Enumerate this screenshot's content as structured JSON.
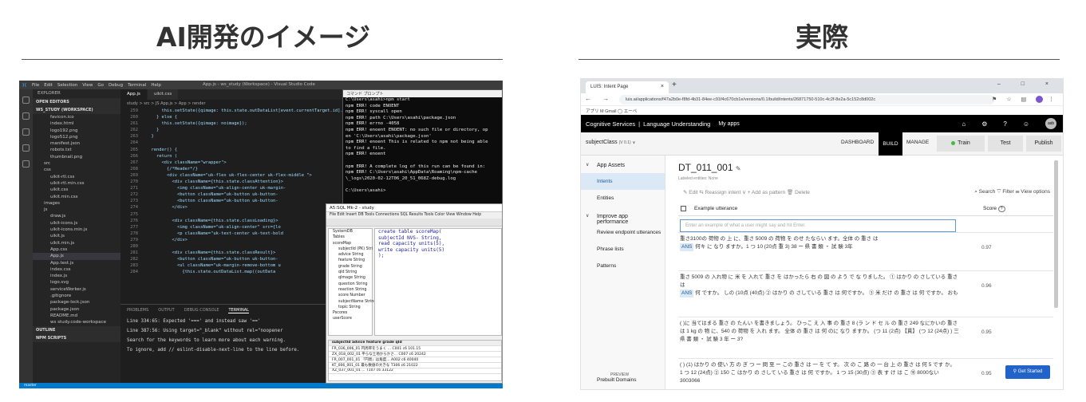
{
  "left": {
    "heading": "AI開発のイメージ",
    "vscode": {
      "menu": [
        "File",
        "Edit",
        "Selection",
        "View",
        "Go",
        "Debug",
        "Terminal",
        "Help"
      ],
      "window_title": "App.js - ws_study (Workspace) - Visual Studio Code",
      "explorer_title": "EXPLORER",
      "sections": [
        "OPEN EDITORS",
        "WS_STUDY (WORKSPACE)"
      ],
      "files": [
        "favicon.ico",
        "index.html",
        "logo192.png",
        "logo512.png",
        "manifest.json",
        "robots.txt",
        "thumbnail.png",
        "src",
        "css",
        "uikit-rtl.css",
        "uikit-rtl.min.css",
        "uikit.css",
        "uikit.min.css",
        "images",
        "js",
        "draw.js",
        "uikit-icons.js",
        "uikit-icons.min.js",
        "uikit.js",
        "uikit.min.js",
        "App.css",
        "App.js",
        "App.test.js",
        "index.css",
        "index.js",
        "logo.svg",
        "serviceWorker.js",
        ".gitignore",
        "package-lock.json",
        "package.json",
        "README.md",
        "ws study.code-workspace"
      ],
      "footer_sections": [
        "OUTLINE",
        "NPM SCRIPTS"
      ],
      "tabs": [
        "App.js",
        "uikit.css"
      ],
      "breadcrumb": "study > src > JS App.js > App > render",
      "code_lines": [
        {
          "n": "259",
          "t": "      this.setState({qimage: this.state.outDataList[event.currentTarget.id].qimage});"
        },
        {
          "n": "260",
          "t": "    } else {"
        },
        {
          "n": "261",
          "t": "      this.setState({qimage: noimage});"
        },
        {
          "n": "262",
          "t": "    }"
        },
        {
          "n": "263",
          "t": "  }"
        },
        {
          "n": "264",
          "t": ""
        },
        {
          "n": "265",
          "t": "  render() {"
        },
        {
          "n": "266",
          "t": "    return ("
        },
        {
          "n": "267",
          "t": "      <div className=\"wrapper\">"
        },
        {
          "n": "268",
          "t": "        {/*Header*/}"
        },
        {
          "n": "269",
          "t": "        <div className=\"uk-flex uk-flex-center uk-flex-middle \">"
        },
        {
          "n": "270",
          "t": "          <div className={this.state.classAttention}>"
        },
        {
          "n": "271",
          "t": "            <img className=\"uk-align-center uk-margin-"
        },
        {
          "n": "272",
          "t": "            <button className=\"uk-button uk-button-"
        },
        {
          "n": "273",
          "t": "            <button className=\"uk-button uk-button-"
        },
        {
          "n": "274",
          "t": "          </div>"
        },
        {
          "n": "275",
          "t": ""
        },
        {
          "n": "276",
          "t": "          <div className={this.state.classLoading}>"
        },
        {
          "n": "277",
          "t": "            <img className=\"uk-align-center\" src={lo"
        },
        {
          "n": "278",
          "t": "            <p className=\"uk-text-center uk-text-bold"
        },
        {
          "n": "279",
          "t": "          </div>"
        },
        {
          "n": "280",
          "t": ""
        },
        {
          "n": "281",
          "t": "          <div className={this.state.classResult}>"
        },
        {
          "n": "282",
          "t": "            <button className=\"uk-button uk-button-"
        },
        {
          "n": "283",
          "t": "            <ul className=\"uk-margin-remove-bottom u"
        },
        {
          "n": "284",
          "t": "              {this.state.outDataList.map((outData"
        }
      ],
      "panel_tabs": [
        "PROBLEMS",
        "OUTPUT",
        "DEBUG CONSOLE",
        "TERMINAL"
      ],
      "panel_lines": [
        "Line 334:65:  Expected '===' and instead saw '=='",
        "Line 387:56:  Using target=\"_blank\" without rel=\"noopener",
        "Search for the keywords to learn more about each warning.",
        "To ignore, add // eslint-disable-next-line to the line before."
      ],
      "status": "master"
    },
    "terminal": {
      "title": "コマンド プロンプト",
      "lines": [
        "C:\\Users\\asahi>npm start",
        "npm ERR! code ENOENT",
        "npm ERR! syscall open",
        "npm ERR! path C:\\Users\\asahi\\package.json",
        "npm ERR! errno -4058",
        "npm ERR! enoent ENOENT: no such file or directory, op",
        "en 'C:\\Users\\asahi\\package.json'",
        "npm ERR! enoent This is related to npm not being able",
        " to find a file.",
        "npm ERR! enoent",
        "",
        "npm ERR! A complete log of this run can be found in:",
        "npm ERR!     C:\\Users\\asahi\\AppData\\Roaming\\npm-cache",
        "\\_logs\\2020-02-12T06_20_51_068Z-debug.log",
        "",
        "C:\\Users\\asahi>"
      ]
    },
    "sql": {
      "title": "A5:SQL Mk-2 - study",
      "menu": "File Edit Insert DB Tools Connections SQL Results Tools Color View Window Help",
      "tree": [
        "SystemDB",
        "Tables",
        "scoreMap",
        "subjectId (PK) Stri",
        "advice String",
        "feature String",
        "grade String",
        "qId String",
        "qImage String",
        "question String",
        "reaction String",
        "score Number",
        "subjectName String",
        "topic String",
        "Pscores",
        "userScore"
      ],
      "editor": [
        "create table scoreMap(",
        "subjectId NVS- String,",
        "read capacity units(5),",
        "write capacity units(5)",
        ");"
      ],
      "grid_header": "subjectId  advice  feature  grade  qId",
      "grid_rows": [
        "FR_036_006_01  円周率をうまく  ...  C001  c6  101.15",
        "ZX_018_002_01  平らな土地からかさ...  C007  c6  20242",
        "FR_007_001_01  『円周』は角度...  A002  c6  40040",
        "KT_006_001_01  最も数値の大きな  T306  c6  21022",
        "XZ_037_001_01  ...  T107  c6  33122"
      ]
    }
  },
  "right": {
    "heading": "実際",
    "browser": {
      "tab_title": "LUIS: Intent Page",
      "url": "luis.ai/applications/f47a2b0e-f8fd-4b31-84ee-c91f4c670cb1e/versions/0.1/build/intents/26871750-510c-4c2f-8e2a-5c152c8d002c",
      "bookmarks": "アプリ  M Gmail  ◯ エーペ"
    },
    "luis": {
      "brand": "Cognitive Services",
      "product": "Language Understanding",
      "myapps": "My apps",
      "app_name": "subjectClass",
      "app_version": "(V 0.1)",
      "nav": [
        "DASHBOARD",
        "BUILD",
        "MANAGE"
      ],
      "train": "Train",
      "test": "Test",
      "publish": "Publish",
      "user_initials": "asb",
      "sidebar": {
        "group1": "App Assets",
        "items1": [
          "Intents",
          "Entities"
        ],
        "group2": "Improve app performance",
        "items2": [
          "Review endpoint utterances",
          "Phrase lists",
          "Patterns"
        ],
        "prebuilt": "Prebuilt Domains",
        "prebuilt_badge": "PREVIEW"
      },
      "intent_title": "DT_011_001",
      "intent_sub": "Labeled entities: None",
      "tools": "✎ Edit   ⇆ Reassign intent ∨   + Add as pattern   🗑 Delete",
      "rtools": "⌕ Search   ▽ Filter   ☰ View options",
      "col_utterance": "Example utterance",
      "col_score": "Score",
      "input_placeholder": "Enter an example of what a user might say and hit Enter.",
      "utterances": [
        {
          "pre": "重さ3100の 荷物 の 上 に、重さ 5009 の 荷物 を のせ たならい ます。全体 の 重さ は",
          "ent": "ANS",
          "post": "何キ に なり ますか。1 つ 10 (20点 重 3) 38 ー 県 書 類 ・ 試 験 3年",
          "score": "0.97"
        },
        {
          "pre": "重さ 5009 の 入れ物 に 米 を 入れて 重さ を はかったら 右 の 図 の よう で な りました。 ① はかり の さしている 重さ は",
          "ent": "ANS",
          "post": "何 ですか。 しの (10点 (40点) ② はかり の さしている 重さ は 何ですか。 ③ 米 だけ の 重さ は 何 ですか。 おも",
          "score": "0.96"
        },
        {
          "pre": "( )に 当てはまる 重さ の たんい を書きましょう。 ひっこ え 入 事 の 重さ 8 (ラ ン ド セ ル の 重さ 249 なにかいの 重さ は 1 kg の 物 に、540 の 荷物 を 入れ ます。 全体 の 重さ は 何 のに なり ますか。 (つ 11 (2点) 【貫】 (つ 12 (24点) ) 三 県 書 類 ・ 試 験 3 年 ー 3?",
          "ent": "",
          "post": "",
          "score": "0.95"
        },
        {
          "pre": "( ) (1) はかり の 使い 方 の ぎ つ ー 問 至 ー この 重さ は 一 を て す。 次 の こ 路 の 一 台 上 の 重さ は 何 5 です か。 1 つ 12 (24点) ② 150 こ はかり の さして いる 重さ は 何 ですか。 1 つ 15 (30点) ③ 表 す け は こ ⑩ 8000ない 3003066",
          "ent": "",
          "post": "",
          "score": "0.95"
        }
      ],
      "get_started": "Get Started"
    }
  },
  "colors": {
    "vscode_bg": "#1e1e1e",
    "statusbar": "#007acc",
    "luis_appbar": "#000000",
    "train_dot": "#3fbd3f",
    "get_started": "#2163c9"
  }
}
